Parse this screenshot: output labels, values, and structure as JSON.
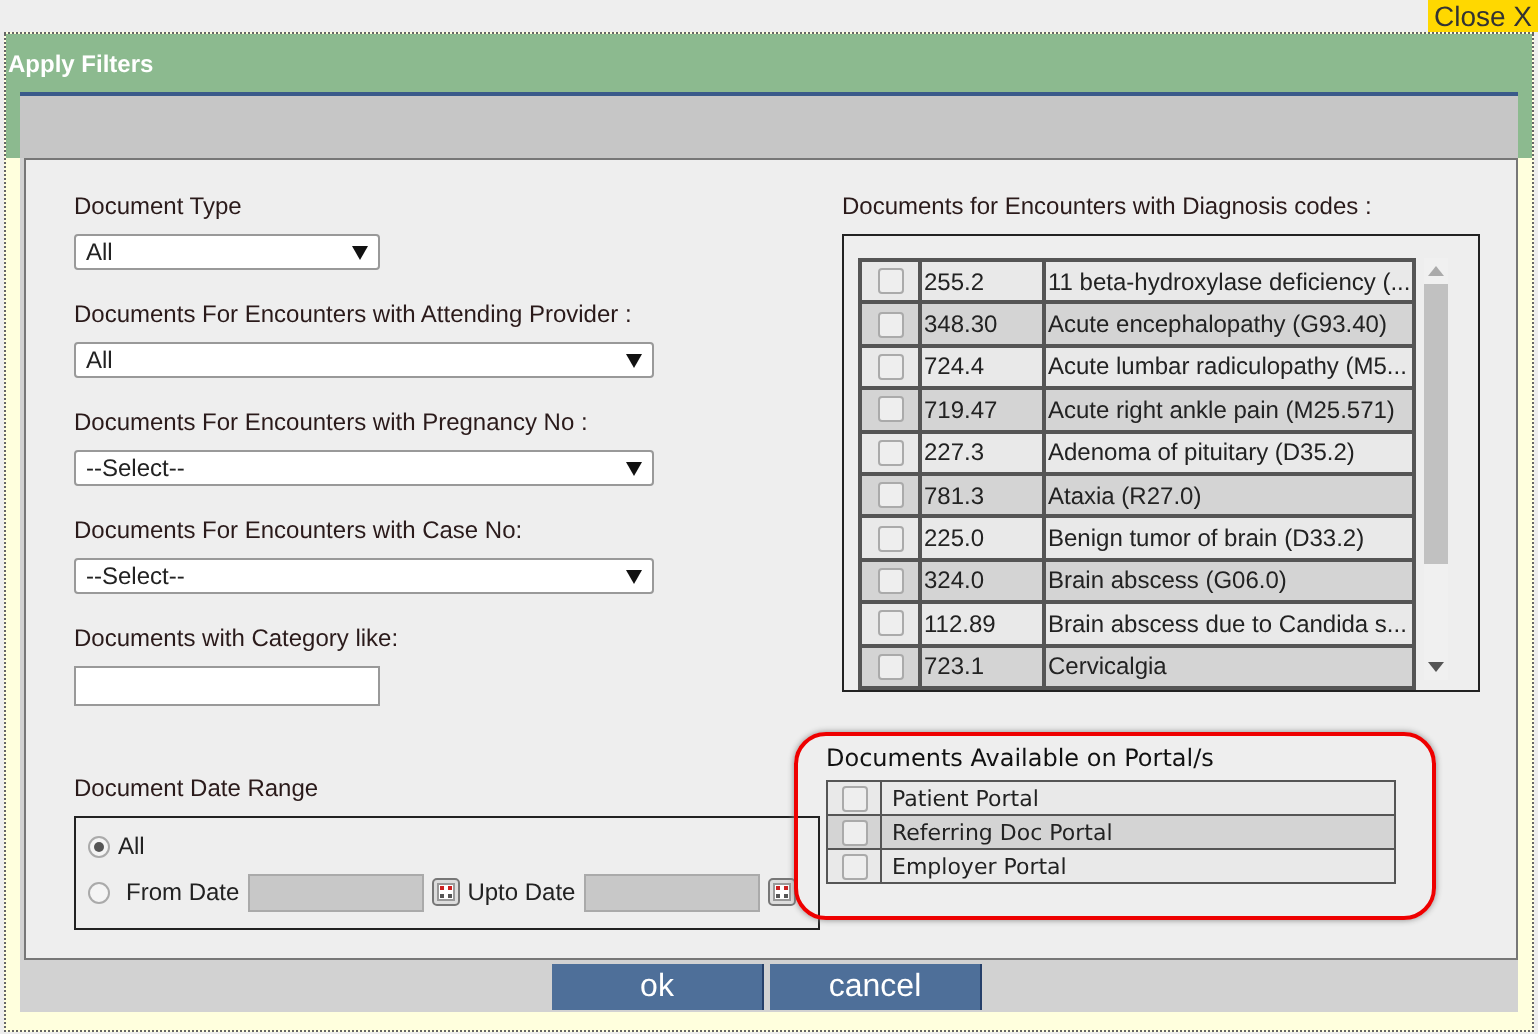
{
  "close_button": {
    "label": "Close X"
  },
  "dialog": {
    "title": "Apply Filters"
  },
  "left_fields": [
    {
      "kind": "dropdown",
      "label": "Document Type",
      "value": "All"
    },
    {
      "kind": "dropdown",
      "label": "Documents For Encounters with Attending Provider :",
      "value": "All"
    },
    {
      "kind": "dropdown",
      "label": "Documents For Encounters with Pregnancy No :",
      "value": "--Select--"
    },
    {
      "kind": "dropdown",
      "label": "Documents For Encounters with Case No:",
      "value": "--Select--"
    },
    {
      "kind": "text",
      "label": "Documents with Category like:"
    }
  ],
  "date_range": {
    "label": "Document Date Range",
    "options": [
      {
        "kind": "all",
        "label": "All",
        "selected": true
      },
      {
        "kind": "range",
        "label": "From Date",
        "selected": false,
        "to_label": "Upto Date"
      }
    ]
  },
  "diagnosis": {
    "label": "Documents for Encounters with Diagnosis codes :",
    "rows": [
      {
        "code": "255.2",
        "name": "11 beta-hydroxylase deficiency (...",
        "checked": false
      },
      {
        "code": "348.30",
        "name": "Acute encephalopathy (G93.40)",
        "checked": false
      },
      {
        "code": "724.4",
        "name": "Acute lumbar radiculopathy (M5...",
        "checked": false
      },
      {
        "code": "719.47",
        "name": "Acute right ankle pain (M25.571)",
        "checked": false
      },
      {
        "code": "227.3",
        "name": "Adenoma of pituitary (D35.2)",
        "checked": false
      },
      {
        "code": "781.3",
        "name": "Ataxia (R27.0)",
        "checked": false
      },
      {
        "code": "225.0",
        "name": "Benign tumor of brain (D33.2)",
        "checked": false
      },
      {
        "code": "324.0",
        "name": "Brain abscess (G06.0)",
        "checked": false
      },
      {
        "code": "112.89",
        "name": "Brain abscess due to Candida s...",
        "checked": false
      },
      {
        "code": "723.1",
        "name": "Cervicalgia",
        "checked": false
      }
    ]
  },
  "portals": {
    "label": "Documents Available on Portal/s",
    "rows": [
      {
        "name": "Patient Portal",
        "checked": false
      },
      {
        "name": "Referring Doc Portal",
        "checked": false
      },
      {
        "name": "Employer Portal",
        "checked": false
      }
    ]
  },
  "buttons": [
    "ok",
    "cancel"
  ]
}
